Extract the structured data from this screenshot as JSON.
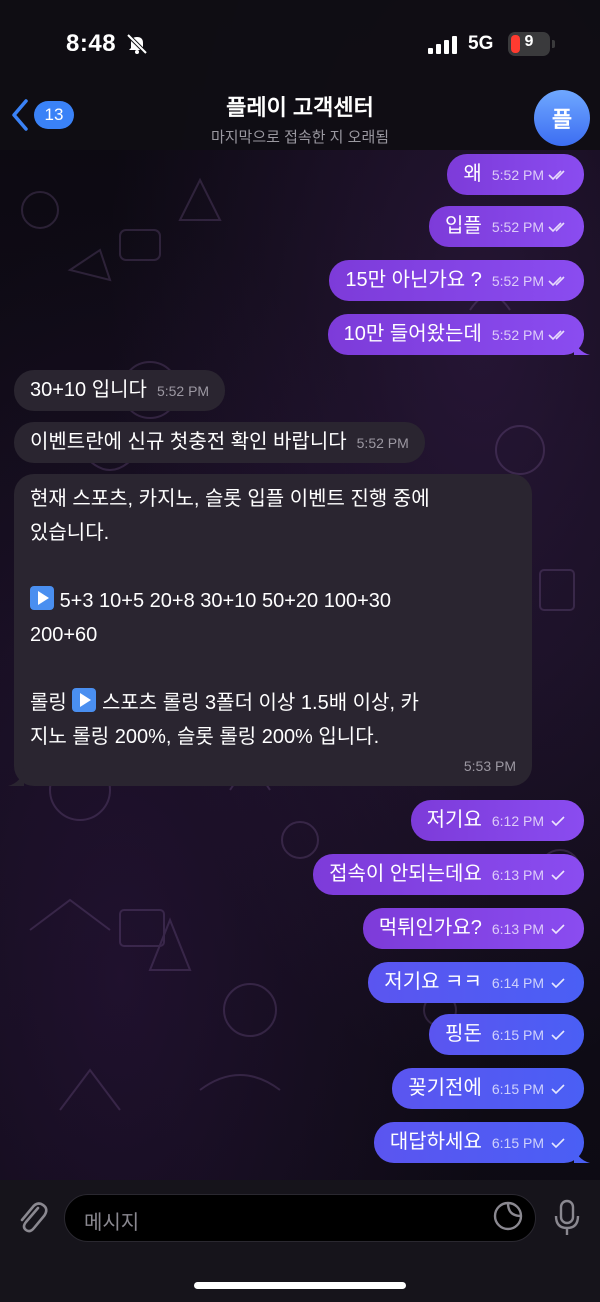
{
  "status_bar": {
    "time": "8:48",
    "network": "5G",
    "battery": "9"
  },
  "header": {
    "back_count": "13",
    "title": "플레이 고객센터",
    "subtitle": "마지막으로 접속한 지 오래됨",
    "avatar_letter": "플"
  },
  "messages": [
    {
      "dir": "out",
      "text": "왜",
      "time": "5:52 PM",
      "read": true
    },
    {
      "dir": "out",
      "text": "입플",
      "time": "5:52 PM",
      "read": true
    },
    {
      "dir": "out",
      "text": "15만 아닌가요 ?",
      "time": "5:52 PM",
      "read": true
    },
    {
      "dir": "out",
      "text": "10만 들어왔는데",
      "time": "5:52 PM",
      "read": true
    },
    {
      "dir": "in",
      "text": "30+10 입니다",
      "time": "5:52 PM"
    },
    {
      "dir": "in",
      "text": "이벤트란에 신규 첫충전 확인 바랍니다",
      "time": "5:52 PM"
    },
    {
      "dir": "in",
      "line1": "현재 스포츠, 카지노, 슬롯 입플 이벤트 진행 중에",
      "line2": "있습니다.",
      "line3": "5+3 10+5 20+8 30+10 50+20 100+30",
      "line4": "200+60",
      "line5a": "롤링",
      "line5b": "스포츠 롤링 3폴더 이상 1.5배 이상, 카",
      "line6": "지노 롤링 200%, 슬롯 롤링 200% 입니다.",
      "time": "5:53 PM"
    },
    {
      "dir": "out",
      "text": "저기요",
      "time": "6:12 PM",
      "read": false
    },
    {
      "dir": "out",
      "text": "접속이 안되는데요",
      "time": "6:13 PM",
      "read": false
    },
    {
      "dir": "out",
      "text": "먹튀인가요?",
      "time": "6:13 PM",
      "read": false
    },
    {
      "dir": "out",
      "text": "저기요 ㅋㅋ",
      "time": "6:14 PM",
      "read": false
    },
    {
      "dir": "out",
      "text": "핑돈",
      "time": "6:15 PM",
      "read": false
    },
    {
      "dir": "out",
      "text": "꽂기전에",
      "time": "6:15 PM",
      "read": false
    },
    {
      "dir": "out",
      "text": "대답하세요",
      "time": "6:15 PM",
      "read": false
    }
  ],
  "input": {
    "placeholder": "메시지"
  }
}
